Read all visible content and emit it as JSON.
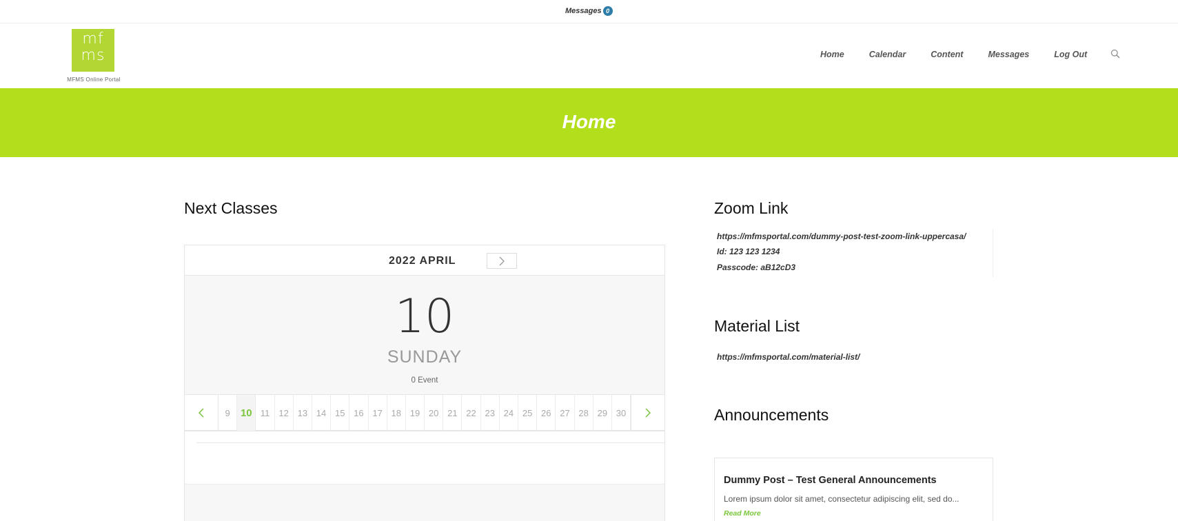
{
  "topbar": {
    "messages_label": "Messages",
    "messages_count": "0"
  },
  "header": {
    "logo_text_line1": "mf",
    "logo_text_line2": "ms",
    "logo_caption": "MFMS Online Portal",
    "nav": [
      {
        "label": "Home"
      },
      {
        "label": "Calendar"
      },
      {
        "label": "Content"
      },
      {
        "label": "Messages"
      },
      {
        "label": "Log Out"
      }
    ],
    "search_icon": "search-icon"
  },
  "banner": {
    "title": "Home",
    "color": "#b2de1c"
  },
  "next_classes": {
    "title": "Next Classes",
    "calendar": {
      "month_label": "2022 APRIL",
      "selected_day": "10",
      "weekday": "SUNDAY",
      "event_count": "0 Event",
      "days": [
        "9",
        "10",
        "11",
        "12",
        "13",
        "14",
        "15",
        "16",
        "17",
        "18",
        "19",
        "20",
        "21",
        "22",
        "23",
        "24",
        "25",
        "26",
        "27",
        "28",
        "29",
        "30"
      ],
      "active_day": "10",
      "accent_color": "#7bc63c"
    }
  },
  "zoom": {
    "title": "Zoom Link",
    "link": "https://mfmsportal.com/dummy-post-test-zoom-link-uppercasa/",
    "id_line": "Id: 123 123 1234",
    "passcode_line": "Passcode: aB12cD3"
  },
  "material": {
    "title": "Material List",
    "link": "https://mfmsportal.com/material-list/"
  },
  "announcements": {
    "title": "Announcements",
    "post_title": "Dummy Post – Test General Announcements",
    "excerpt": "Lorem ipsum dolor sit amet, consectetur adipiscing elit, sed do...",
    "read_more": "Read More"
  }
}
